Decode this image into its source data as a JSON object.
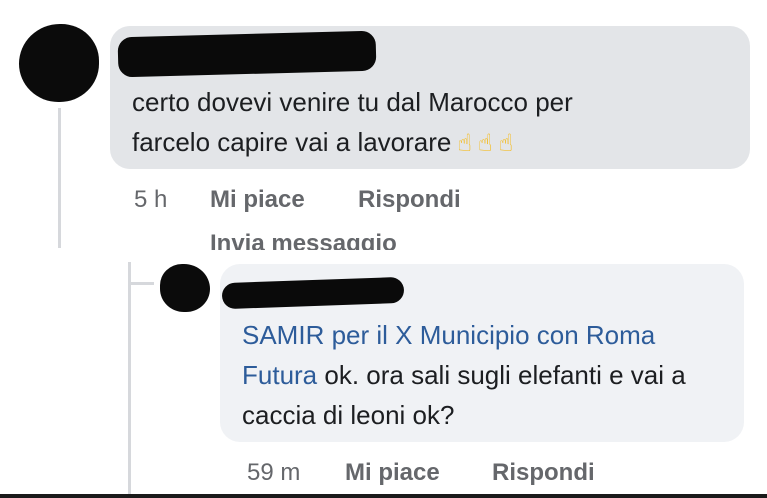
{
  "comment": {
    "text_line1": "certo dovevi venire tu  dal Marocco per",
    "text_line2": "farcelo capire vai a lavorare",
    "emojis": [
      "☝",
      "☝",
      "☝"
    ],
    "time": "5 h",
    "like_label": "Mi piace",
    "reply_label": "Rispondi",
    "message_label": "Invia messaggio"
  },
  "reply": {
    "mention": "SAMIR per il X Municipio con Roma Futura",
    "text": "ok. ora sali sugli elefanti e vai a caccia di leoni ok?",
    "time": "59 m",
    "like_label": "Mi piace",
    "reply_label": "Rispondi"
  },
  "colors": {
    "comment_bubble": "#e3e5e8",
    "reply_bubble": "#f0f2f5",
    "mention_link": "#2d5c9a",
    "meta_text": "#65676b"
  }
}
